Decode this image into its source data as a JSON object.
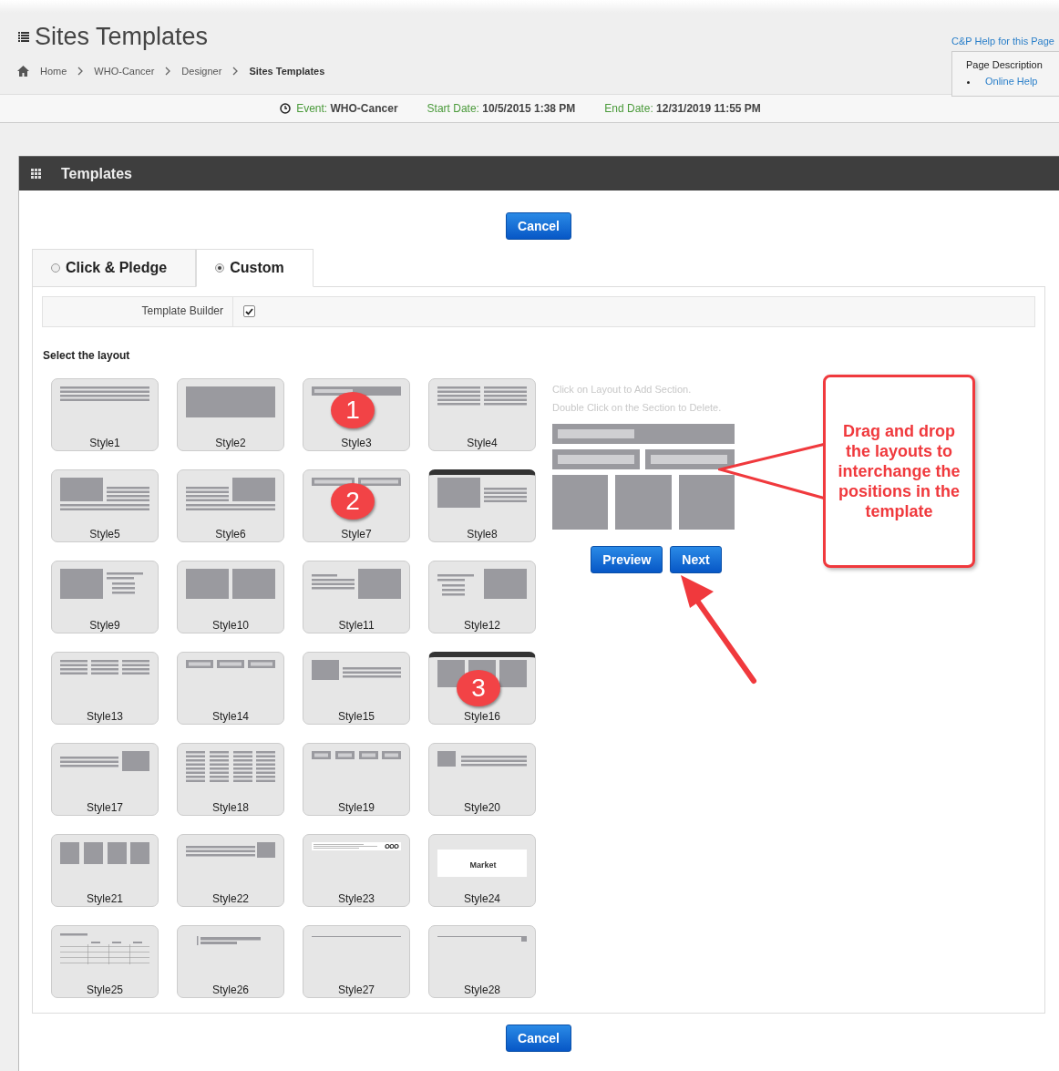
{
  "header": {
    "title": "Sites Templates",
    "help_link": "C&P Help for this Page",
    "help_menu": {
      "title": "Page Description",
      "items": [
        "Online Help"
      ]
    }
  },
  "breadcrumbs": [
    {
      "label": "Home",
      "current": false
    },
    {
      "label": "WHO-Cancer",
      "current": false
    },
    {
      "label": "Designer",
      "current": false
    },
    {
      "label": "Sites Templates",
      "current": true
    }
  ],
  "event_bar": [
    {
      "label": "Event:",
      "value": "WHO-Cancer"
    },
    {
      "label": "Start Date:",
      "value": "10/5/2015 1:38 PM"
    },
    {
      "label": "End Date:",
      "value": "12/31/2019 11:55 PM"
    }
  ],
  "panel": {
    "title": "Templates",
    "top_button": "Cancel",
    "bottom_button": "Cancel"
  },
  "tabs": [
    {
      "label": "Click & Pledge",
      "selected": false
    },
    {
      "label": "Custom",
      "selected": true
    }
  ],
  "template_builder": {
    "label": "Template Builder",
    "checked": true
  },
  "layout_heading": "Select the layout",
  "layouts": [
    {
      "label": "Style1",
      "kind": "text"
    },
    {
      "label": "Style2",
      "kind": "banner"
    },
    {
      "label": "Style3",
      "kind": "titlebar",
      "badge": "1"
    },
    {
      "label": "Style4",
      "kind": "twotext"
    },
    {
      "label": "Style5",
      "kind": "imageleft"
    },
    {
      "label": "Style6",
      "kind": "imageright"
    },
    {
      "label": "Style7",
      "kind": "twobars",
      "badge": "2"
    },
    {
      "label": "Style8",
      "kind": "headerimage"
    },
    {
      "label": "Style9",
      "kind": "imageshort"
    },
    {
      "label": "Style10",
      "kind": "twoimages"
    },
    {
      "label": "Style11",
      "kind": "linesimage"
    },
    {
      "label": "Style12",
      "kind": "shortimage"
    },
    {
      "label": "Style13",
      "kind": "threetext"
    },
    {
      "label": "Style14",
      "kind": "threebars"
    },
    {
      "label": "Style15",
      "kind": "smallimage"
    },
    {
      "label": "Style16",
      "kind": "headerthree",
      "badge": "3"
    },
    {
      "label": "Style17",
      "kind": "linessmall"
    },
    {
      "label": "Style18",
      "kind": "fourtext"
    },
    {
      "label": "Style19",
      "kind": "fourbars"
    },
    {
      "label": "Style20",
      "kind": "tinyimage"
    },
    {
      "label": "Style21",
      "kind": "fourimages"
    },
    {
      "label": "Style22",
      "kind": "doubleline"
    },
    {
      "label": "Style23",
      "kind": "strip"
    },
    {
      "label": "Style24",
      "kind": "masthead",
      "thumb_text": "Market"
    },
    {
      "label": "Style25",
      "kind": "table"
    },
    {
      "label": "Style26",
      "kind": "sidebar"
    },
    {
      "label": "Style27",
      "kind": "rule"
    },
    {
      "label": "Style28",
      "kind": "rulesquare"
    }
  ],
  "preview": {
    "hints": [
      "Click on Layout to Add Section.",
      "Double Click on the Section to Delete."
    ],
    "buttons": [
      "Preview",
      "Next"
    ]
  },
  "callout": {
    "text": "Drag and drop the layouts to interchange the positions in the template"
  }
}
